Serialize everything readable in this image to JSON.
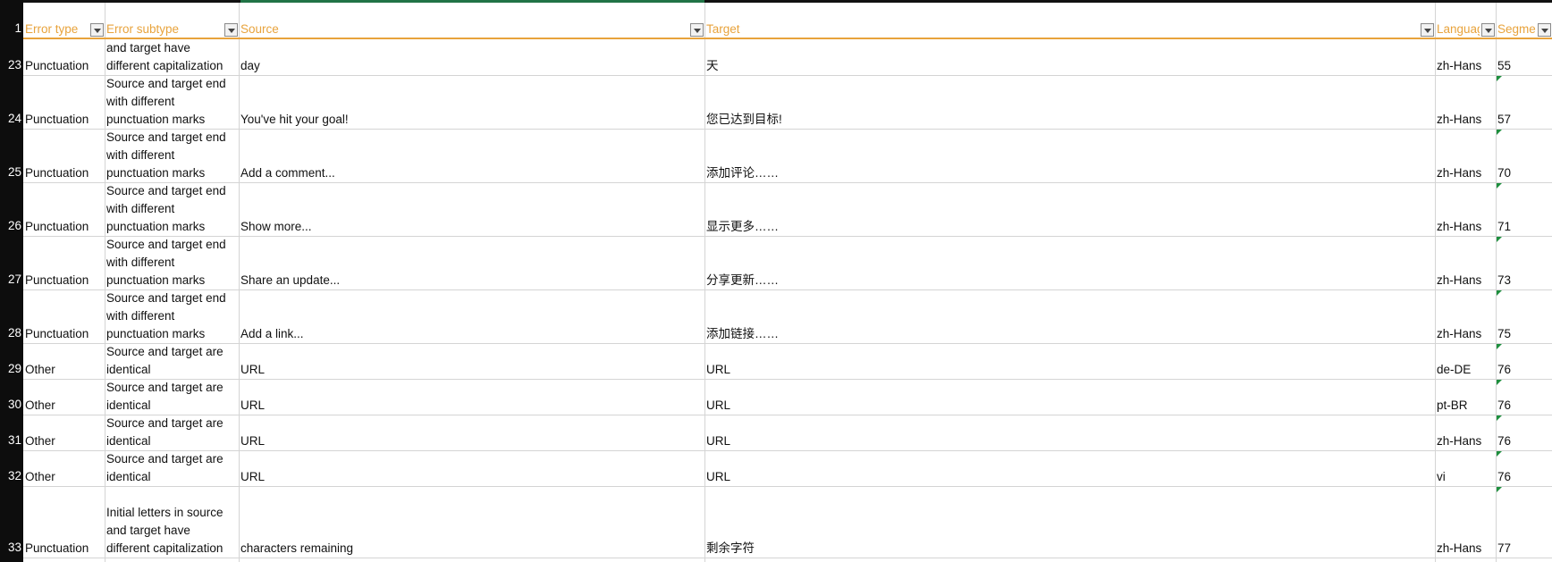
{
  "header_row_number": "1",
  "columns": [
    "Error type",
    "Error subtype",
    "Source",
    "Target",
    "Languag",
    "Segme"
  ],
  "rows": [
    {
      "num": "23",
      "error_type": "Punctuation",
      "subtype_lines": [
        "and target have",
        "different capitalization"
      ],
      "source": "day",
      "target": "天",
      "language": "zh-Hans",
      "segment": "55"
    },
    {
      "num": "24",
      "error_type": "Punctuation",
      "subtype_lines": [
        "Source and target end",
        "with different",
        "punctuation marks"
      ],
      "source": "You've hit your goal!",
      "target": "您已达到目标!",
      "language": "zh-Hans",
      "segment": "57"
    },
    {
      "num": "25",
      "error_type": "Punctuation",
      "subtype_lines": [
        "Source and target end",
        "with different",
        "punctuation marks"
      ],
      "source": "Add a comment...",
      "target": "添加评论……",
      "language": "zh-Hans",
      "segment": "70"
    },
    {
      "num": "26",
      "error_type": "Punctuation",
      "subtype_lines": [
        "Source and target end",
        "with different",
        "punctuation marks"
      ],
      "source": "Show more...",
      "target": "显示更多……",
      "language": "zh-Hans",
      "segment": "71"
    },
    {
      "num": "27",
      "error_type": "Punctuation",
      "subtype_lines": [
        "Source and target end",
        "with different",
        "punctuation marks"
      ],
      "source": "Share an update...",
      "target": "分享更新……",
      "language": "zh-Hans",
      "segment": "73"
    },
    {
      "num": "28",
      "error_type": "Punctuation",
      "subtype_lines": [
        "Source and target end",
        "with different",
        "punctuation marks"
      ],
      "source": "Add a link...",
      "target": "添加链接……",
      "language": "zh-Hans",
      "segment": "75"
    },
    {
      "num": "29",
      "error_type": "Other",
      "subtype_lines": [
        "Source and target are",
        "identical"
      ],
      "source": "URL",
      "target": "URL",
      "language": "de-DE",
      "segment": "76"
    },
    {
      "num": "30",
      "error_type": "Other",
      "subtype_lines": [
        "Source and target are",
        "identical"
      ],
      "source": "URL",
      "target": "URL",
      "language": "pt-BR",
      "segment": "76"
    },
    {
      "num": "31",
      "error_type": "Other",
      "subtype_lines": [
        "Source and target are",
        "identical"
      ],
      "source": "URL",
      "target": "URL",
      "language": "zh-Hans",
      "segment": "76"
    },
    {
      "num": "32",
      "error_type": "Other",
      "subtype_lines": [
        "Source and target are",
        "identical"
      ],
      "source": "URL",
      "target": "URL",
      "language": "vi",
      "segment": "76"
    },
    {
      "num": "33",
      "error_type": "Punctuation",
      "subtype_lines": [
        "Initial letters in source",
        "and target have",
        "different capitalization"
      ],
      "source": "characters remaining",
      "target": "剩余字符",
      "language": "zh-Hans",
      "segment": "77"
    }
  ],
  "colors": {
    "header_text": "#e8a33c",
    "grid": "#d4d4d4",
    "row_header_bg": "#0d0d0d",
    "comment_flag": "#1e8f3e"
  }
}
